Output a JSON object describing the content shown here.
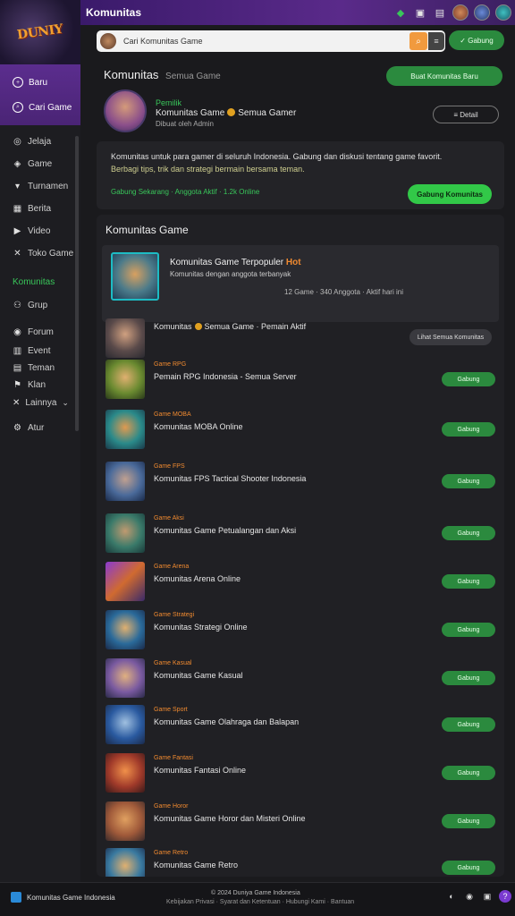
{
  "topbar": {
    "title": "Komunitas",
    "icons": [
      "diamond-icon",
      "calendar-icon",
      "bookmark-icon",
      "avatar-1",
      "avatar-2",
      "avatar-3"
    ]
  },
  "logo": {
    "text": "DUNIY"
  },
  "sidebar": {
    "active_items": [
      {
        "icon": "plus-circle-icon",
        "label": "Baru"
      },
      {
        "icon": "search-circle-icon",
        "label": "Cari Game"
      }
    ],
    "items": [
      {
        "icon": "compass-icon",
        "label": "Jelaja"
      },
      {
        "icon": "game-icon",
        "label": "Game"
      },
      {
        "icon": "trophy-icon",
        "label": "Turnamen"
      },
      {
        "icon": "news-icon",
        "label": "Berita"
      },
      {
        "icon": "video-icon",
        "label": "Video"
      },
      {
        "icon": "store-icon",
        "label": "Toko Game"
      }
    ],
    "section_label": "Komunitas",
    "section_items": [
      {
        "icon": "group-icon",
        "label": "Grup"
      },
      {
        "icon": "chat-icon",
        "label": "Forum"
      },
      {
        "icon": "event-icon",
        "label": "Event"
      },
      {
        "icon": "friends-icon",
        "label": "Teman"
      },
      {
        "icon": "clan-icon",
        "label": "Klan"
      },
      {
        "icon": "more-icon",
        "label": "Lainnya",
        "chevron": "⌄"
      },
      {
        "icon": "settings-icon",
        "label": "Atur"
      }
    ]
  },
  "search": {
    "placeholder": "Cari Komunitas Game",
    "button_icon": "search-icon"
  },
  "top_button": "✓ Gabung",
  "community": {
    "title": "Komunitas",
    "subtitle": "Semua Game",
    "create_button": "Buat Komunitas Baru",
    "profile_line1": "Pemilik",
    "profile_line2a": "Komunitas Game",
    "profile_line2b": "Semua Gamer",
    "profile_line3": "Dibuat oleh Admin",
    "outline_button": "≡ Detail",
    "desc1": "Komunitas untuk para gamer di seluruh Indonesia. Gabung dan diskusi tentang game favorit.",
    "desc2": "Berbagi tips, trik dan strategi bermain bersama teman.",
    "desc3": "Gabung Sekarang · Anggota Aktif · 1.2k Online",
    "join_button": "Gabung Komunitas"
  },
  "list": {
    "title": "Komunitas Game",
    "featured": {
      "title": "Komunitas Game Terpopuler",
      "title_accent": "Hot",
      "sub": "Komunitas dengan anggota terbanyak",
      "meta": "12 Game · 340 Anggota · Aktif hari ini"
    },
    "rows": [
      {
        "sub": "",
        "name_a": "Komunitas",
        "name_b": "Semua Game · Pemain Aktif",
        "button": "Lihat Semua Komunitas",
        "gray": true
      },
      {
        "sub": "Game RPG",
        "name_a": "Pemain RPG Indonesia - Semua Server",
        "name_b": "",
        "button": "Gabung"
      },
      {
        "sub": "Game MOBA",
        "name_a": "Komunitas MOBA Online",
        "name_b": "",
        "button": "Gabung"
      },
      {
        "sub": "Game FPS",
        "name_a": "Komunitas FPS Tactical Shooter Indonesia",
        "name_b": "",
        "button": "Gabung"
      },
      {
        "sub": "Game Aksi",
        "name_a": "Komunitas Game Petualangan dan Aksi",
        "name_b": "",
        "button": "Gabung"
      },
      {
        "sub": "Game Arena",
        "name_a": "Komunitas Arena Online",
        "name_b": "",
        "button": "Gabung"
      },
      {
        "sub": "Game Strategi",
        "name_a": "Komunitas Strategi Online",
        "name_b": "",
        "button": "Gabung"
      },
      {
        "sub": "Game Kasual",
        "name_a": "Komunitas Game Kasual",
        "name_b": "",
        "button": "Gabung"
      },
      {
        "sub": "Game Sport",
        "name_a": "Komunitas Game Olahraga dan Balapan",
        "name_b": "",
        "button": "Gabung"
      },
      {
        "sub": "Game Fantasi",
        "name_a": "Komunitas Fantasi Online",
        "name_b": "",
        "button": "Gabung"
      },
      {
        "sub": "Game Horor",
        "name_a": "Komunitas Game Horor dan Misteri Online",
        "name_b": "",
        "button": "Gabung"
      },
      {
        "sub": "Game Retro",
        "name_a": "Komunitas Game Retro",
        "name_b": "",
        "button": "Gabung"
      }
    ]
  },
  "footer": {
    "left": "Komunitas Game Indonesia",
    "center1": "© 2024 Duniya Game Indonesia",
    "center2": "Kebijakan Privasi · Syarat dan Ketentuan · Hubungi Kami · Bantuan"
  }
}
